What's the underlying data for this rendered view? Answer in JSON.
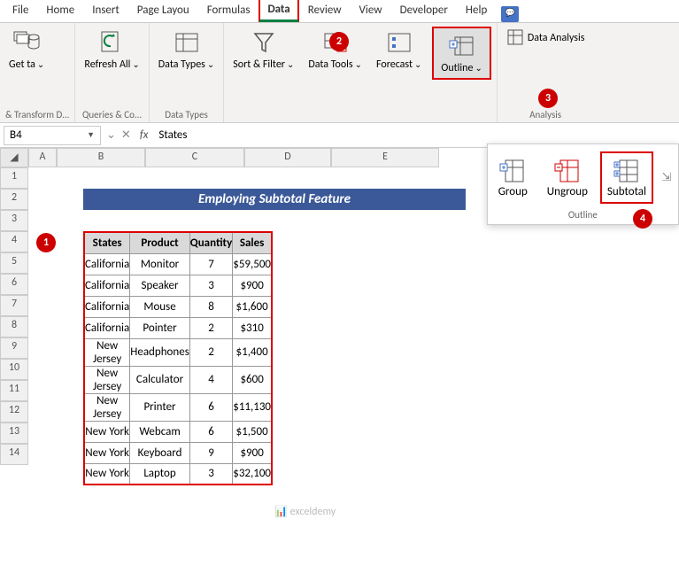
{
  "tabs": {
    "file": "File",
    "home": "Home",
    "insert": "Insert",
    "layout": "Page Layou",
    "formulas": "Formulas",
    "data": "Data",
    "review": "Review",
    "view": "View",
    "developer": "Developer",
    "help": "Help"
  },
  "ribbon": {
    "get_data": "Get\nta",
    "transform": "& Transform D...",
    "refresh": "Refresh\nAll",
    "queries": "Queries & Co...",
    "types": "Data\nTypes",
    "types_grp": "Data Types",
    "sort": "Sort &\nFilter",
    "tools": "Data\nTools",
    "forecast": "Forecast",
    "outline": "Outline",
    "analysis": "Data Analysis",
    "analysis_grp": "Analysis"
  },
  "outline_menu": {
    "group": "Group",
    "ungroup": "Ungroup",
    "subtotal": "Subtotal",
    "name": "Outline"
  },
  "namebox": "B4",
  "formula": "States",
  "cols": [
    "",
    "A",
    "B",
    "C",
    "D",
    "E"
  ],
  "rows": [
    "1",
    "2",
    "3",
    "4",
    "5",
    "6",
    "7",
    "8",
    "9",
    "10",
    "11",
    "12",
    "13",
    "14"
  ],
  "title": "Employing Subtotal Feature",
  "headers": {
    "c1": "States",
    "c2": "Product",
    "c3": "Quantity",
    "c4": "Sales"
  },
  "data": [
    {
      "s": "California",
      "p": "Monitor",
      "q": "7",
      "v": "$59,500"
    },
    {
      "s": "California",
      "p": "Speaker",
      "q": "3",
      "v": "$900"
    },
    {
      "s": "California",
      "p": "Mouse",
      "q": "8",
      "v": "$1,600"
    },
    {
      "s": "California",
      "p": "Pointer",
      "q": "2",
      "v": "$310"
    },
    {
      "s": "New Jersey",
      "p": "Headphones",
      "q": "2",
      "v": "$1,400"
    },
    {
      "s": "New Jersey",
      "p": "Calculator",
      "q": "4",
      "v": "$600"
    },
    {
      "s": "New Jersey",
      "p": "Printer",
      "q": "6",
      "v": "$11,130"
    },
    {
      "s": "New York",
      "p": "Webcam",
      "q": "6",
      "v": "$1,500"
    },
    {
      "s": "New York",
      "p": "Keyboard",
      "q": "9",
      "v": "$900"
    },
    {
      "s": "New York",
      "p": "Laptop",
      "q": "3",
      "v": "$32,100"
    }
  ],
  "badges": {
    "b1": "1",
    "b2": "2",
    "b3": "3",
    "b4": "4"
  },
  "watermark": "📊 exceldemy"
}
